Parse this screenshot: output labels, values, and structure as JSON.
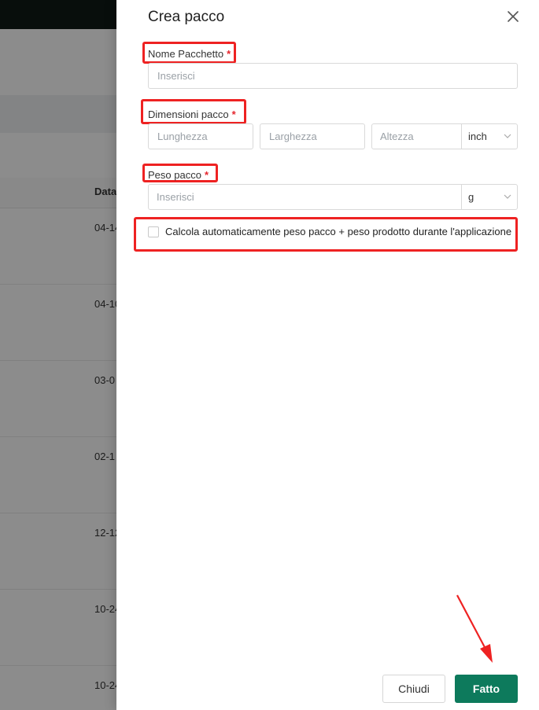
{
  "background": {
    "table_header": "Data",
    "dates": [
      "04-14",
      "04-10",
      "03-0",
      "02-1",
      "12-12",
      "10-24",
      "10-24"
    ]
  },
  "drawer": {
    "title": "Crea pacco",
    "name_field": {
      "label": "Nome Pacchetto",
      "required_mark": "*",
      "placeholder": "Inserisci",
      "value": ""
    },
    "dimensions": {
      "label": "Dimensioni pacco",
      "required_mark": "*",
      "length_placeholder": "Lunghezza",
      "width_placeholder": "Larghezza",
      "height_placeholder": "Altezza",
      "unit": "inch"
    },
    "weight": {
      "label": "Peso pacco",
      "required_mark": "*",
      "placeholder": "Inserisci",
      "unit": "g"
    },
    "auto_calc": {
      "label": "Calcola automaticamente peso pacco + peso prodotto durante l'applicazione",
      "checked": false
    },
    "buttons": {
      "close_label": "Chiudi",
      "done_label": "Fatto"
    }
  },
  "colors": {
    "primary_button": "#0d7a5c",
    "highlight_box": "#ee2222",
    "required_asterisk": "#e5262e"
  }
}
